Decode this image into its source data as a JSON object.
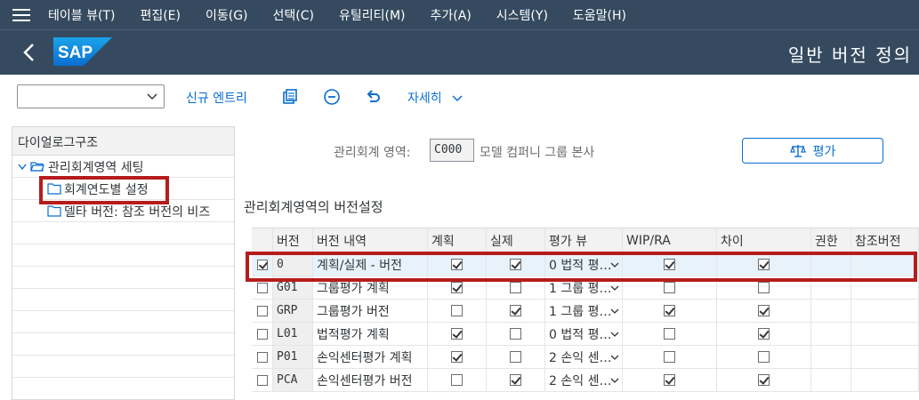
{
  "menubar": {
    "items": [
      "테이블 뷰(T)",
      "편집(E)",
      "이동(G)",
      "선택(C)",
      "유틸리티(M)",
      "추가(A)",
      "시스템(Y)",
      "도움말(H)"
    ]
  },
  "shell": {
    "logo_text": "SAP",
    "title": "일반 버전 정의"
  },
  "toolbar": {
    "combo_value": "",
    "new_entry": "신규 엔트리",
    "details": "자세히",
    "icons": [
      "copy-icon",
      "remove-icon",
      "undo-icon"
    ]
  },
  "tree": {
    "header": "다이얼로그구조",
    "nodes": [
      {
        "label": "관리회계영역 세팅",
        "level": 0
      },
      {
        "label": "회계연도별 설정",
        "level": 1
      },
      {
        "label": "델타 버전: 참조 버전의 비즈",
        "level": 1
      }
    ]
  },
  "filter": {
    "label": "관리회계 영역:",
    "value": "C000",
    "description": "모델 컴퍼니 그룹 본사"
  },
  "evaluate_button": "평가",
  "section_title": "관리회계영역의 버전설정",
  "table": {
    "columns": [
      "버전",
      "버전 내역",
      "계획",
      "실제",
      "평가 뷰",
      "WIP/RA",
      "차이",
      "권한",
      "참조버전"
    ],
    "rows": [
      {
        "selected": true,
        "version": "0",
        "desc": "계획/실제 - 버전",
        "plan": true,
        "actual": true,
        "view": "0 법적 평…",
        "wip": true,
        "variance": true
      },
      {
        "selected": false,
        "version": "G01",
        "desc": "그룹평가 계획",
        "plan": true,
        "actual": false,
        "view": "1 그룹 평…",
        "wip": false,
        "variance": false
      },
      {
        "selected": false,
        "version": "GRP",
        "desc": "그룹평가 버전",
        "plan": false,
        "actual": true,
        "view": "1 그룹 평…",
        "wip": true,
        "variance": true
      },
      {
        "selected": false,
        "version": "L01",
        "desc": "법적평가 계획",
        "plan": true,
        "actual": false,
        "view": "0 법적 평…",
        "wip": false,
        "variance": true
      },
      {
        "selected": false,
        "version": "P01",
        "desc": "손익센터평가 계획",
        "plan": true,
        "actual": false,
        "view": "2 손익 센…",
        "wip": false,
        "variance": false
      },
      {
        "selected": false,
        "version": "PCA",
        "desc": "손익센터평가 버전",
        "plan": false,
        "actual": true,
        "view": "2 손익 센…",
        "wip": true,
        "variance": true
      }
    ]
  },
  "colors": {
    "shell": "#354a5f",
    "link": "#0a6ed1",
    "highlight": "#b71c1c"
  }
}
